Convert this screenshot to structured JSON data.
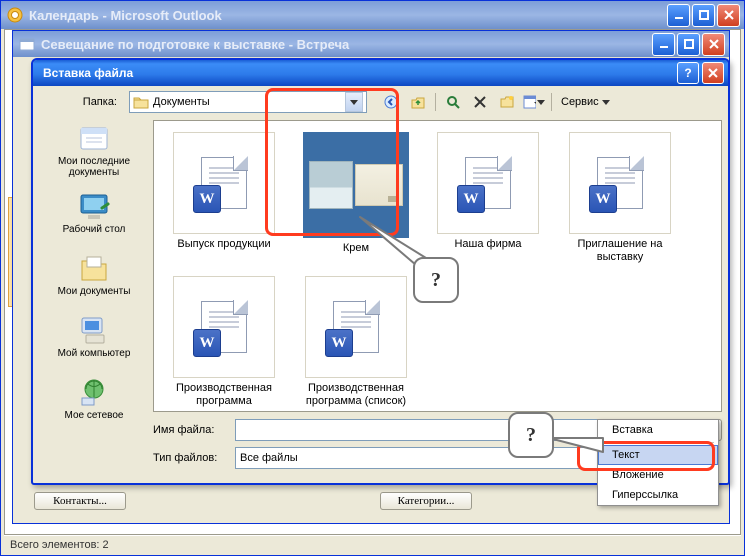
{
  "outlook": {
    "title": "Календарь - Microsoft Outlook"
  },
  "meeting": {
    "title": "Севещание по подготовке к выставке - Встреча",
    "contacts_btn": "Контакты...",
    "categories_btn": "Категории..."
  },
  "statusbar": {
    "text": "Всего элементов: 2"
  },
  "dialog": {
    "title": "Вставка файла",
    "folder_label": "Папка:",
    "folder_value": "Документы",
    "service_label": "Сервис",
    "filename_label": "Имя файла:",
    "filename_value": "",
    "filetype_label": "Тип файлов:",
    "filetype_value": "Все файлы",
    "insert_btn": "Вставка"
  },
  "places": {
    "recent": "Мои последние документы",
    "desktop": "Рабочий стол",
    "mydocs": "Мои документы",
    "mycomp": "Мой компьютер",
    "network": "Мое сетевое"
  },
  "files": [
    {
      "name": "Выпуск продукции",
      "kind": "word"
    },
    {
      "name": "Крем",
      "kind": "image",
      "selected": true
    },
    {
      "name": "Наша фирма",
      "kind": "word"
    },
    {
      "name": "Приглашение на выставку",
      "kind": "word"
    },
    {
      "name": "Производственная программа",
      "kind": "word"
    },
    {
      "name": "Производственная программа (список)",
      "kind": "word"
    }
  ],
  "dropdown": {
    "items": [
      "Вставка",
      "Текст",
      "Вложение",
      "Гиперссылка"
    ],
    "hover_index": 1
  },
  "callout": {
    "q": "?"
  }
}
